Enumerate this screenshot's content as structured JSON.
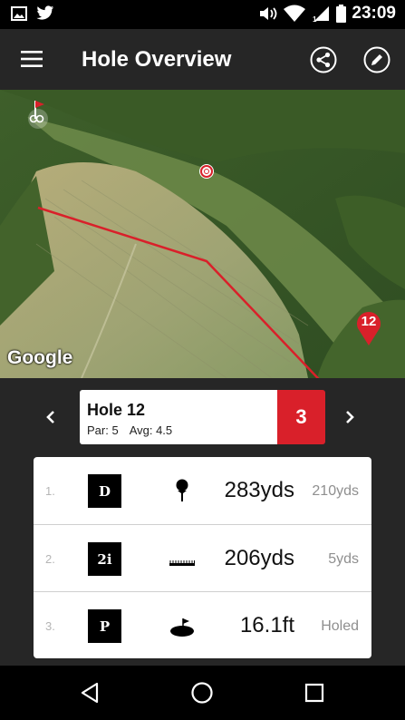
{
  "status": {
    "time": "23:09",
    "signal_sub": "1",
    "net_badge": "R"
  },
  "header": {
    "title": "Hole Overview",
    "menu_icon": "menu-icon",
    "share_icon": "share-icon",
    "edit_icon": "edit-icon"
  },
  "map": {
    "google_label": "Google",
    "pin_label": "12"
  },
  "hole": {
    "name": "Hole 12",
    "par": "Par: 5",
    "avg": "Avg: 4.5",
    "score": "3",
    "score_color": "#d9202a"
  },
  "shots": [
    {
      "num": "1.",
      "club": "D",
      "icon": "tee-icon",
      "distance": "283yds",
      "remaining": "210yds"
    },
    {
      "num": "2.",
      "club": "2i",
      "icon": "fairway-icon",
      "distance": "206yds",
      "remaining": "5yds"
    },
    {
      "num": "3.",
      "club": "P",
      "icon": "green-icon",
      "distance": "16.1ft",
      "remaining": "Holed"
    }
  ]
}
